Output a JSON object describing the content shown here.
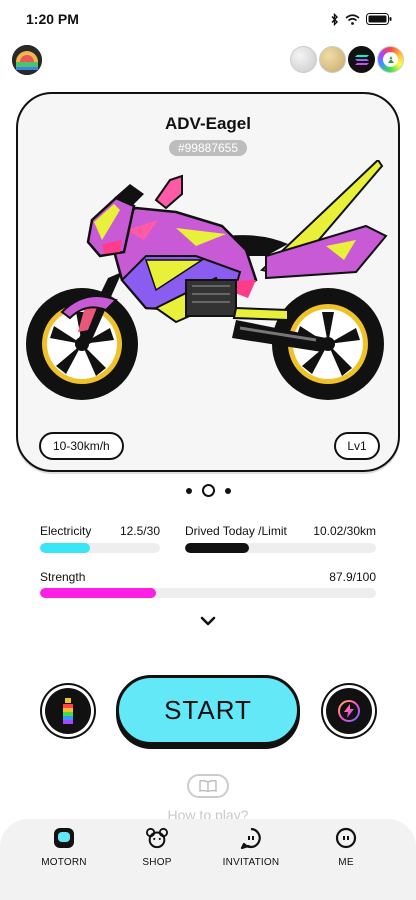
{
  "status_bar": {
    "time": "1:20 PM"
  },
  "bike": {
    "name": "ADV-Eagel",
    "id": "#99887655",
    "speed": "10-30km/h",
    "level": "Lv1"
  },
  "carousel": {
    "count": 3,
    "active_index": 1
  },
  "stats": {
    "electricity": {
      "label": "Electricity",
      "value": "12.5/30",
      "fraction": 0.417,
      "color": "#39e6f6"
    },
    "drived": {
      "label": "Drived Today /Limit",
      "value": "10.02/30km",
      "fraction": 0.334,
      "color": "#111111"
    },
    "strength": {
      "label": "Strength",
      "value": "87.9/100",
      "fraction": 0.345,
      "color": "#ff1ee3"
    }
  },
  "actions": {
    "start_label": "START"
  },
  "help": {
    "label": "How to play?"
  },
  "nav": {
    "items": [
      {
        "label": "MOTORN",
        "icon": "motorn-icon"
      },
      {
        "label": "SHOP",
        "icon": "shop-icon"
      },
      {
        "label": "INVITATION",
        "icon": "invitation-icon"
      },
      {
        "label": "ME",
        "icon": "me-icon"
      }
    ]
  },
  "colors": {
    "accent": "#62e8f7",
    "bike_primary": "#c85ad6",
    "bike_secondary": "#e8f03a",
    "bike_tertiary": "#8a5cf0"
  }
}
